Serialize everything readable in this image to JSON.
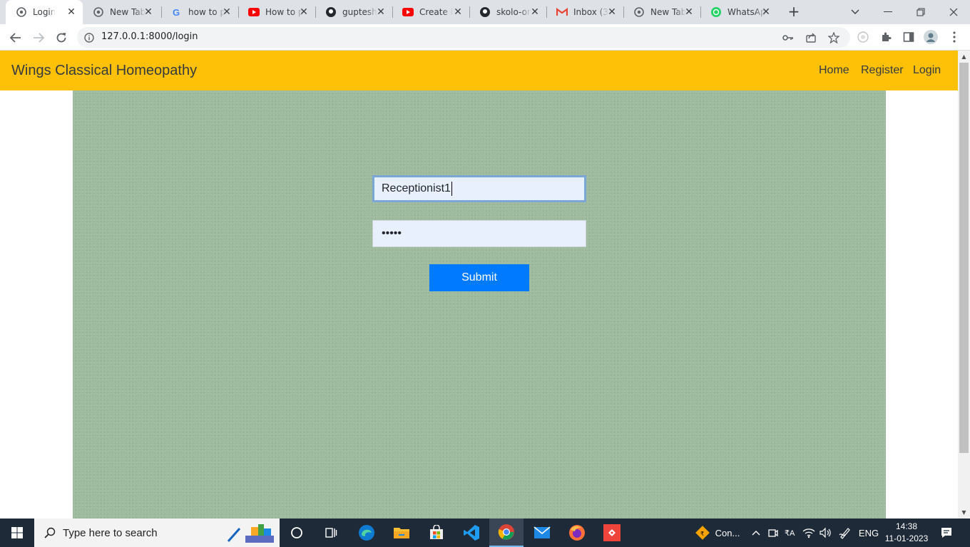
{
  "browser": {
    "tabs": [
      {
        "label": "Login",
        "icon": "chrome-page-icon",
        "active": true
      },
      {
        "label": "New Tab",
        "icon": "chrome-icon"
      },
      {
        "label": "how to p",
        "icon": "google-icon"
      },
      {
        "label": "How to p",
        "icon": "youtube-icon"
      },
      {
        "label": "guptesh",
        "icon": "github-icon"
      },
      {
        "label": "Create l",
        "icon": "youtube-icon"
      },
      {
        "label": "skolo-or",
        "icon": "github-icon"
      },
      {
        "label": "Inbox (3",
        "icon": "gmail-icon"
      },
      {
        "label": "New Tab",
        "icon": "chrome-icon"
      },
      {
        "label": "WhatsAp",
        "icon": "whatsapp-icon"
      }
    ],
    "url": "127.0.0.1:8000/login"
  },
  "page": {
    "brand": "Wings Classical Homeopathy",
    "nav": {
      "home": "Home",
      "register": "Register",
      "login": "Login"
    },
    "form": {
      "username_value": "Receptionist1",
      "password_masked": "•••••",
      "submit_label": "Submit"
    },
    "colors": {
      "navbar": "#ffc107",
      "background": "#9ebb9f",
      "button": "#007bff"
    }
  },
  "taskbar": {
    "search_placeholder": "Type here to search",
    "tray_app_label": "Con...",
    "language": "ENG",
    "time": "14:38",
    "date": "11-01-2023"
  }
}
